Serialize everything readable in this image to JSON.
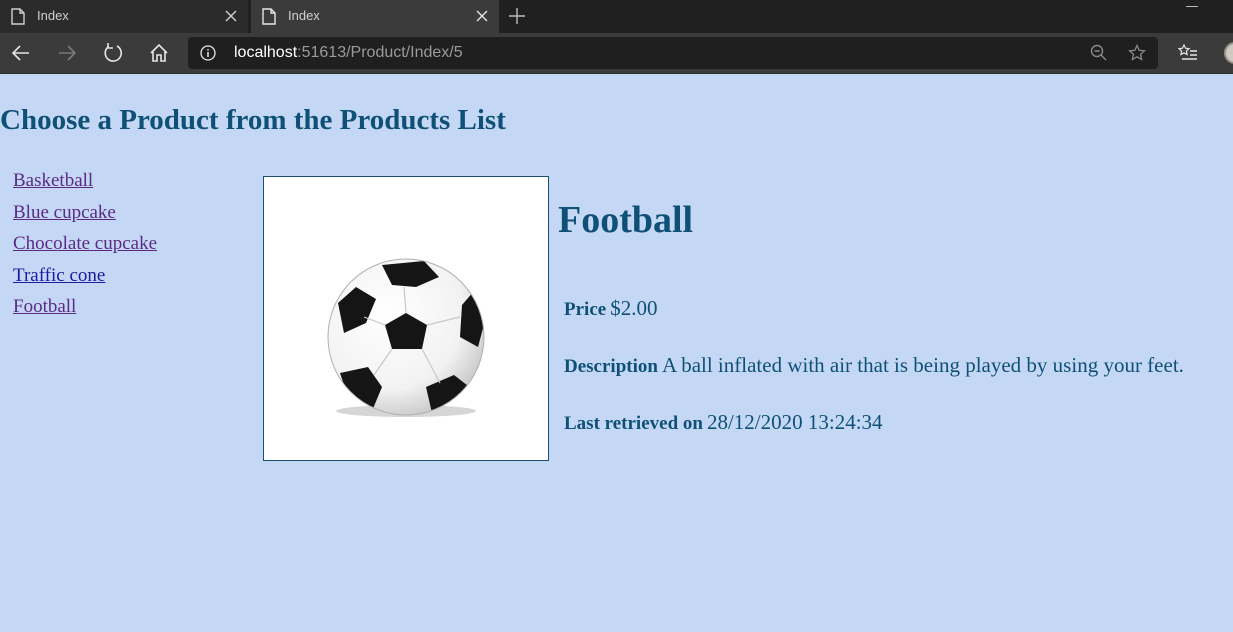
{
  "browser": {
    "tabs": [
      {
        "title": "Index"
      },
      {
        "title": "Index"
      }
    ],
    "address": {
      "host": "localhost",
      "rest": ":51613/Product/Index/5"
    }
  },
  "page": {
    "title": "Choose a Product from the Products List",
    "products": [
      {
        "label": "Basketball"
      },
      {
        "label": "Blue cupcake"
      },
      {
        "label": "Chocolate cupcake"
      },
      {
        "label": "Traffic cone"
      },
      {
        "label": "Football"
      }
    ],
    "selected": {
      "name": "Football",
      "image_icon": "soccer-ball",
      "price_label": "Price",
      "price_value": "$2.00",
      "description_label": "Description",
      "description_value": "A ball inflated with air that is being played by using your feet.",
      "retrieved_label": "Last retrieved on",
      "retrieved_value": "28/12/2020 13:24:34"
    }
  },
  "colors": {
    "page_background": "#c4d8f5",
    "heading_text": "#0f5077",
    "visited_link": "#5b2a86",
    "link": "#1d1aa0"
  }
}
